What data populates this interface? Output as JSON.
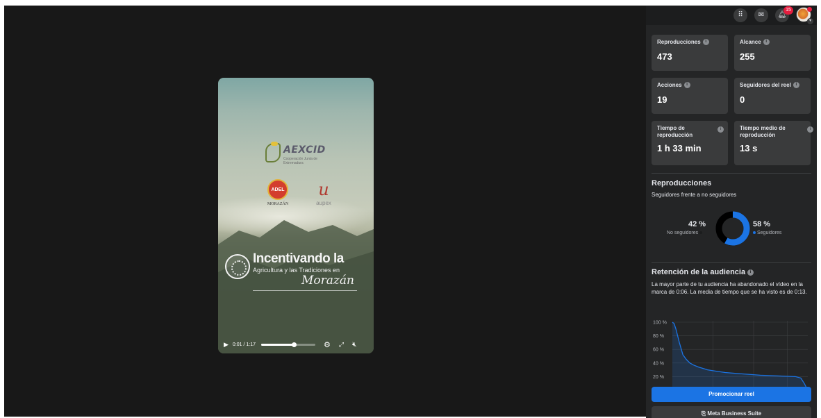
{
  "player": {
    "time": "0:01 / 1:17",
    "progress": 0.6
  },
  "video_content": {
    "logo1_name": "AEXCID",
    "logo1_sub": "Cooperación\nJunta de Extremadura",
    "logo2_name": "ADEL",
    "logo2_sub": "MORAZÁN",
    "logo3_name": "aupex",
    "title_main": "Incentivando la",
    "title_sub": "Agricultura y las Tradiciones en",
    "title_script": "Morazán"
  },
  "topbar": {
    "notifications_count": "15"
  },
  "stats": [
    {
      "label": "Reproducciones",
      "value": "473"
    },
    {
      "label": "Alcance",
      "value": "255"
    },
    {
      "label": "Acciones",
      "value": "19"
    },
    {
      "label": "Seguidores del reel",
      "value": "0"
    },
    {
      "label": "Tiempo de reproducción",
      "value": "1 h 33 min"
    },
    {
      "label": "Tiempo medio de reproducción",
      "value": "13 s"
    }
  ],
  "reproducciones": {
    "title": "Reproducciones",
    "subtitle": "Seguidores frente a no seguidores",
    "non_followers_pct": "42 %",
    "non_followers_label": "No seguidores",
    "followers_pct": "58 %",
    "followers_label": "Seguidores",
    "non_followers_color": "#000000",
    "followers_color": "#1b74e4"
  },
  "retencion": {
    "title": "Retención de la audiencia",
    "description": "La mayor parte de tu audiencia ha abandonado el vídeo en la marca de 0:06. La media de tiempo que se ha visto es de 0:13."
  },
  "chart_data": {
    "type": "area",
    "y_tick_labels": [
      "100 %",
      "80 %",
      "60 %",
      "40 %",
      "20 %"
    ],
    "ylim": [
      0,
      100
    ],
    "xlim": [
      0,
      77
    ],
    "grid": true,
    "series": [
      {
        "x": [
          0,
          1,
          2,
          4,
          6,
          8,
          10,
          12,
          15,
          20,
          25,
          30,
          40,
          50,
          60,
          70,
          73,
          75,
          77
        ],
        "values": [
          100,
          98,
          90,
          70,
          52,
          45,
          40,
          37,
          34,
          30,
          28,
          26,
          24,
          22,
          21,
          20,
          18,
          10,
          0
        ]
      }
    ],
    "line_color": "#1b74e4"
  },
  "buttons": {
    "promote": "Promocionar reel",
    "business_suite": "Meta Business Suite"
  }
}
